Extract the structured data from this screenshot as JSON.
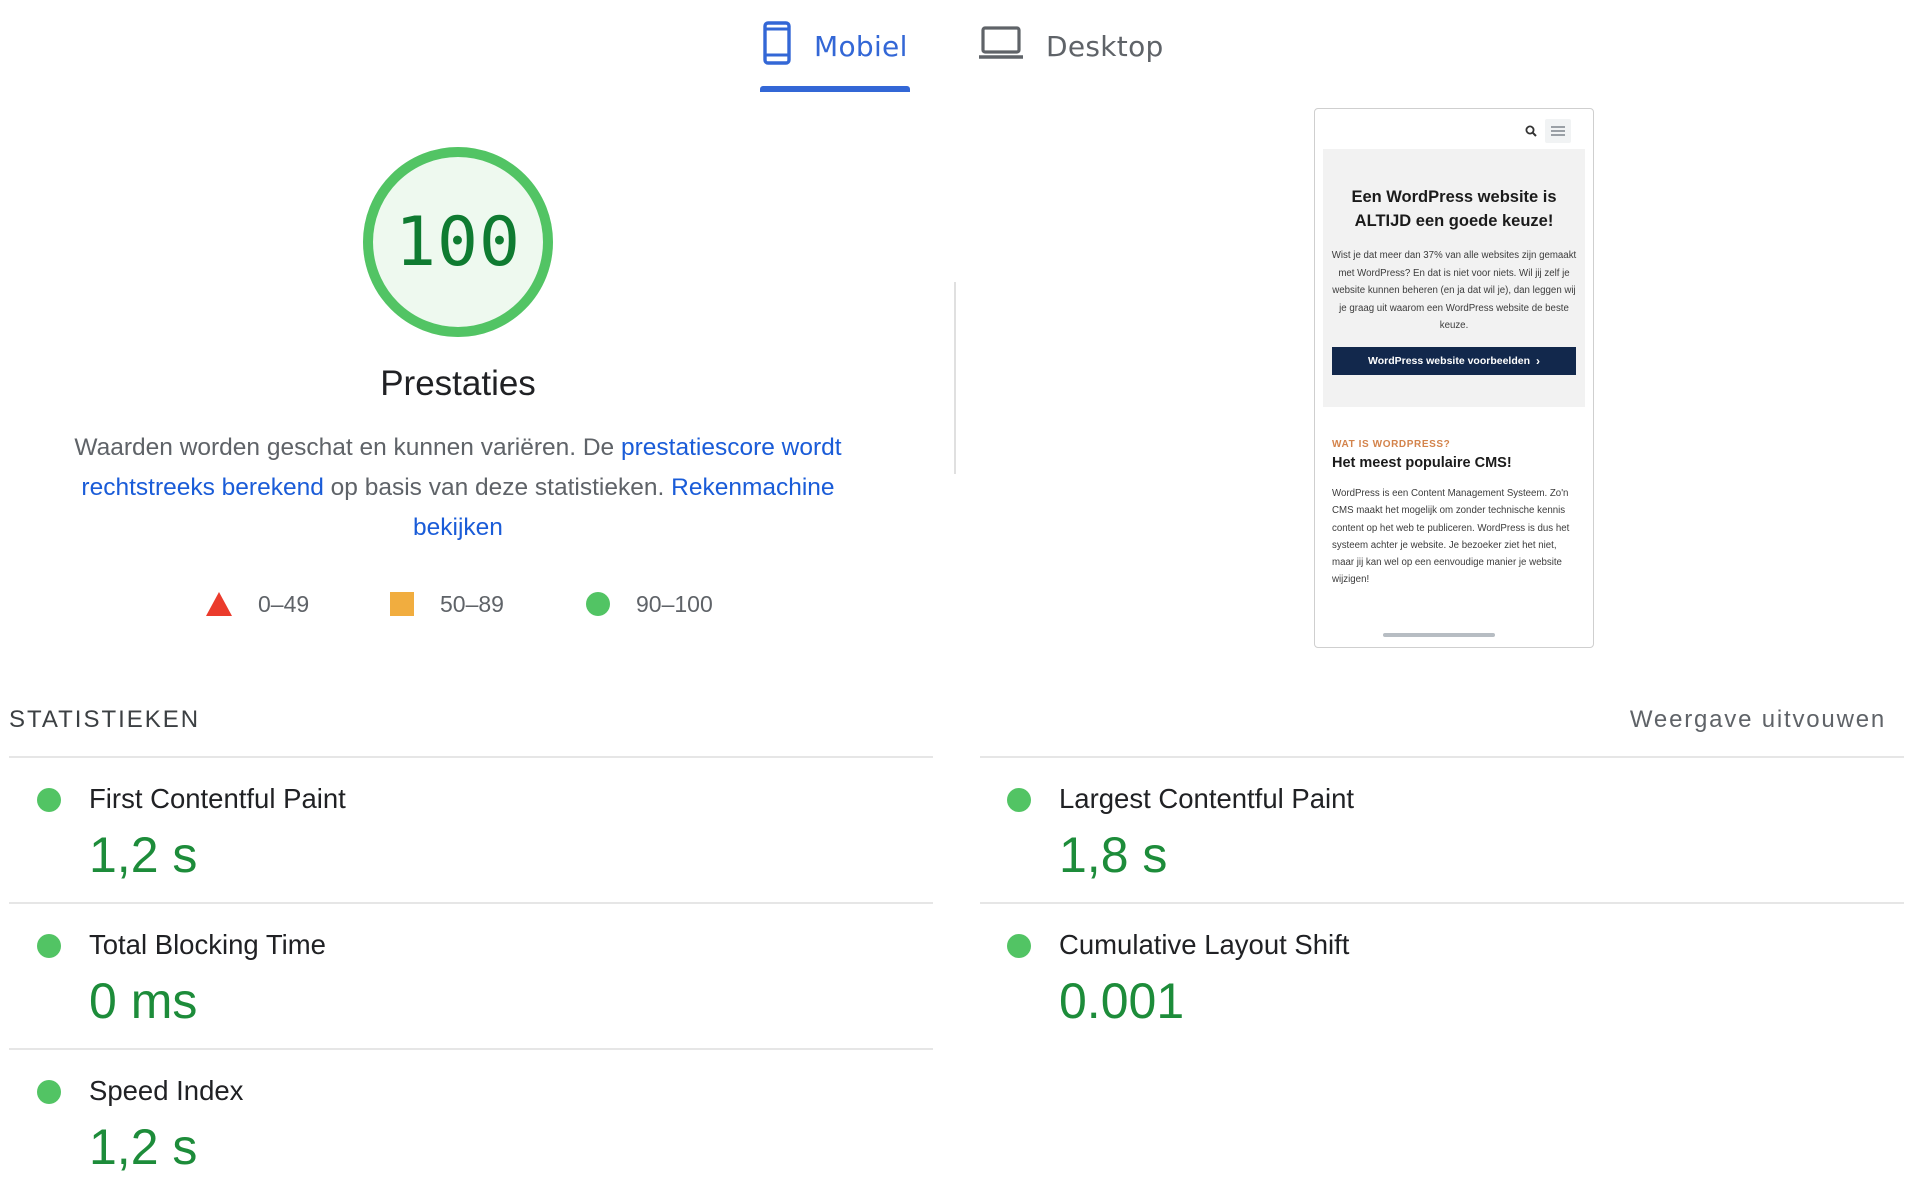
{
  "tabs": {
    "mobile": {
      "label": "Mobiel",
      "icon": "smartphone-icon",
      "active": true
    },
    "desktop": {
      "label": "Desktop",
      "icon": "laptop-icon",
      "active": false
    },
    "active_color": "#3367d6"
  },
  "score": {
    "value": "100",
    "fraction": 1.0,
    "title": "Prestaties",
    "ring_color": "#52c464",
    "value_color": "#0f7b31"
  },
  "description": {
    "text_before": "Waarden worden geschat en kunnen variëren. De ",
    "link1": "prestatiescore wordt rechtstreeks berekend",
    "text_middle": " op basis van deze statistieken. ",
    "link2": "Rekenmachine bekijken"
  },
  "legend": {
    "fail": {
      "range": "0–49",
      "icon": "triangle-icon",
      "color": "#eb3b2c"
    },
    "average": {
      "range": "50–89",
      "icon": "square-icon",
      "color": "#f1ad3f"
    },
    "pass": {
      "range": "90–100",
      "icon": "circle-icon",
      "color": "#52c464"
    }
  },
  "thumbnail": {
    "hero_title": "Een WordPress website is ALTIJD een goede keuze!",
    "hero_text": "Wist je dat meer dan 37% van alle websites zijn gemaakt met WordPress? En dat is niet voor niets. Wil jij zelf je website kunnen beheren (en ja dat wil je), dan leggen wij je graag uit waarom een WordPress website de beste keuze.",
    "cta": "WordPress website voorbeelden",
    "kicker": "WAT IS WORDPRESS?",
    "heading": "Het meest populaire CMS!",
    "body": "WordPress is een Content Management Systeem. Zo'n CMS maakt het mogelijk om zonder technische kennis content op het web te publiceren. WordPress is dus het systeem achter je website. Je bezoeker ziet het niet, maar jij kan wel op een eenvoudige manier je website wijzigen!"
  },
  "metrics": {
    "section_title": "STATISTIEKEN",
    "expand_label": "Weergave uitvouwen",
    "items": [
      {
        "name": "First Contentful Paint",
        "value": "1,2 s",
        "status": "pass"
      },
      {
        "name": "Largest Contentful Paint",
        "value": "1,8 s",
        "status": "pass"
      },
      {
        "name": "Total Blocking Time",
        "value": "0 ms",
        "status": "pass"
      },
      {
        "name": "Cumulative Layout Shift",
        "value": "0.001",
        "status": "pass"
      },
      {
        "name": "Speed Index",
        "value": "1,2 s",
        "status": "pass"
      }
    ]
  }
}
